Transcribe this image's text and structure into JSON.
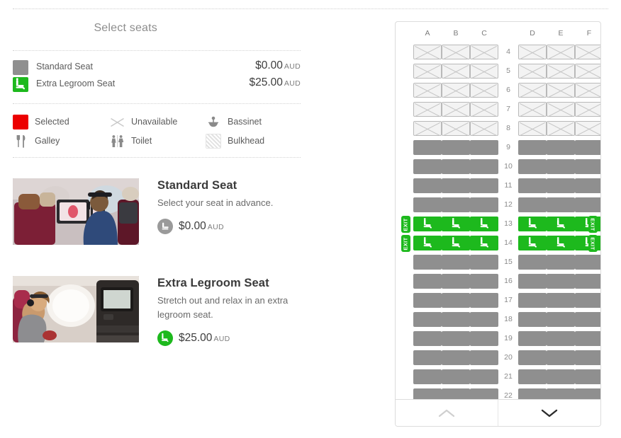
{
  "header": {
    "title": "Select seats"
  },
  "price_legend": [
    {
      "name": "Standard Seat",
      "price": "$0.00",
      "currency": "AUD",
      "icon": "standard-seat-swatch",
      "color": "#8f8f8f"
    },
    {
      "name": "Extra Legroom Seat",
      "price": "$25.00",
      "currency": "AUD",
      "icon": "extra-legroom-seat-swatch",
      "color": "#1db91d"
    }
  ],
  "legend": [
    {
      "label": "Selected",
      "icon": "selected-swatch",
      "color": "#ec0000"
    },
    {
      "label": "Unavailable",
      "icon": "unavailable-cross-icon"
    },
    {
      "label": "Bassinet",
      "icon": "bassinet-icon"
    },
    {
      "label": "Galley",
      "icon": "galley-icon"
    },
    {
      "label": "Toilet",
      "icon": "toilet-icon"
    },
    {
      "label": "Bulkhead",
      "icon": "bulkhead-swatch"
    }
  ],
  "cards": [
    {
      "title": "Standard Seat",
      "description": "Select your seat in advance.",
      "price": "$0.00",
      "currency": "AUD",
      "badge_icon": "seat-icon",
      "badge_color": "#9a9a9a",
      "image_alt": "standard-seat-photo"
    },
    {
      "title": "Extra Legroom Seat",
      "description": "Stretch out and relax in an extra legroom seat.",
      "price": "$25.00",
      "currency": "AUD",
      "badge_icon": "legroom-seat-icon",
      "badge_color": "#1db91d",
      "image_alt": "extra-legroom-seat-photo"
    }
  ],
  "seatmap": {
    "columns_left": [
      "A",
      "B",
      "C"
    ],
    "columns_right": [
      "D",
      "E",
      "F"
    ],
    "exit_label": "EXIT",
    "colors": {
      "standard": "#8f8f8f",
      "legroom": "#1db91d",
      "unavailable": "#f3f3f3",
      "selected": "#ec0000"
    },
    "rows": [
      {
        "number": "4",
        "type": "unavailable",
        "exit": false
      },
      {
        "number": "5",
        "type": "unavailable",
        "exit": false
      },
      {
        "number": "6",
        "type": "unavailable",
        "exit": false
      },
      {
        "number": "7",
        "type": "unavailable",
        "exit": false
      },
      {
        "number": "8",
        "type": "unavailable",
        "exit": false
      },
      {
        "number": "9",
        "type": "standard",
        "exit": false
      },
      {
        "number": "10",
        "type": "standard",
        "exit": false
      },
      {
        "number": "11",
        "type": "standard",
        "exit": false
      },
      {
        "number": "12",
        "type": "standard",
        "exit": false
      },
      {
        "number": "13",
        "type": "legroom",
        "exit": true
      },
      {
        "number": "14",
        "type": "legroom",
        "exit": true
      },
      {
        "number": "15",
        "type": "standard",
        "exit": false
      },
      {
        "number": "16",
        "type": "standard",
        "exit": false
      },
      {
        "number": "17",
        "type": "standard",
        "exit": false
      },
      {
        "number": "18",
        "type": "standard",
        "exit": false
      },
      {
        "number": "19",
        "type": "standard",
        "exit": false
      },
      {
        "number": "20",
        "type": "standard",
        "exit": false
      },
      {
        "number": "21",
        "type": "standard",
        "exit": false
      },
      {
        "number": "22",
        "type": "standard",
        "exit": false
      }
    ],
    "controls": {
      "scroll_up": "scroll-up",
      "scroll_down": "scroll-down",
      "up_enabled": false,
      "down_enabled": true
    }
  }
}
